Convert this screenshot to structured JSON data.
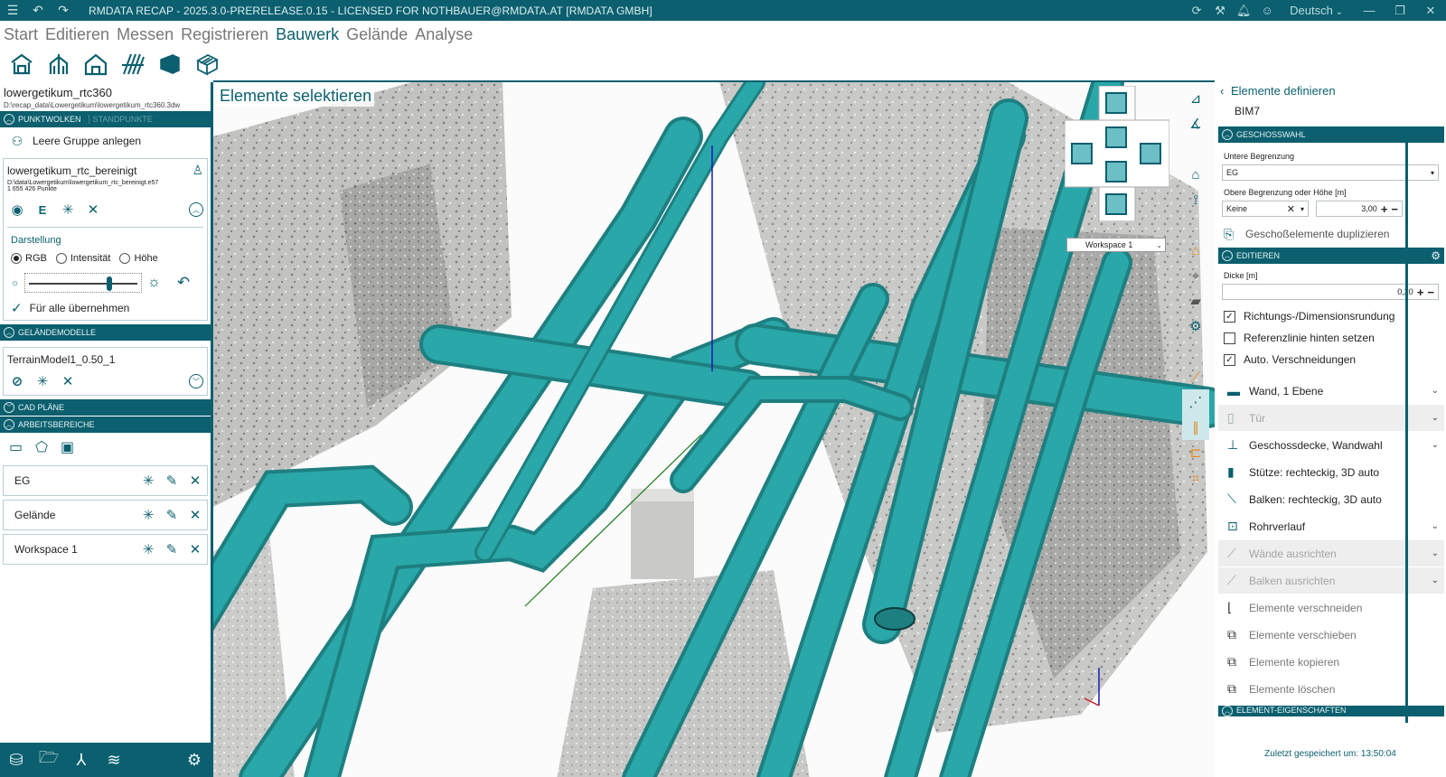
{
  "titlebar": {
    "title": "RMDATA RECAP - 2025.3.0-PRERELEASE.0.15 - LICENSED FOR NOTHBAUER@RMDATA.AT [RMDATA GMBH]",
    "language": "Deutsch"
  },
  "menu": {
    "items": [
      "Start",
      "Editieren",
      "Messen",
      "Registrieren",
      "Bauwerk",
      "Gelände",
      "Analyse"
    ],
    "active": "Bauwerk"
  },
  "left": {
    "project_name": "lowergetikum_rtc360",
    "project_path": "D:\\recap_data\\Lowergetikum\\lowergetikum_rtc360.3dw",
    "pointclouds_header": "PUNKTWOLKEN",
    "standpoints_header": "STANDPUNKTE",
    "new_group": "Leere Gruppe anlegen",
    "cloud": {
      "name": "lowergetikum_rtc_bereinigt",
      "path": "D:\\data\\Lowergetikum\\lowergetikum_rtc_bereinigt.e57",
      "points": "1 655 426 Punkte",
      "e_label": "E"
    },
    "display": {
      "title": "Darstellung",
      "options": [
        "RGB",
        "Intensität",
        "Höhe"
      ],
      "apply_all": "Für alle übernehmen"
    },
    "terrain_header": "GELÄNDEMODELLE",
    "terrain_model": "TerrainModel1_0.50_1",
    "cad_header": "CAD PLÄNE",
    "workspaces_header": "ARBEITSBEREICHE",
    "workspaces": [
      "EG",
      "Gelände",
      "Workspace 1"
    ]
  },
  "viewport": {
    "title": "Elemente selektieren",
    "workspace_select": "Workspace 1"
  },
  "right": {
    "back_title": "Elemente definieren",
    "subtitle": "BIM7",
    "floor_header": "GESCHOSSWAHL",
    "lower_label": "Untere Begrenzung",
    "lower_value": "EG",
    "upper_label": "Obere Begrenzung oder Höhe [m]",
    "upper_value": "Keine",
    "upper_height": "3,00",
    "duplicate_label": "Geschoßelemente duplizieren",
    "edit_header": "EDITIEREN",
    "thickness_label": "Dicke [m]",
    "thickness_value": "0,20",
    "checks": [
      {
        "label": "Richtungs-/Dimensionsrundung",
        "checked": true
      },
      {
        "label": "Referenzlinie hinten setzen",
        "checked": false
      },
      {
        "label": "Auto. Verschneidungen",
        "checked": true
      }
    ],
    "items": [
      {
        "label": "Wand, 1 Ebene",
        "icon": "wall-icon",
        "grey": false,
        "chev": true
      },
      {
        "label": "Tür",
        "icon": "door-icon",
        "grey": true,
        "chev": true
      },
      {
        "label": "Geschossdecke, Wandwahl",
        "icon": "slab-icon",
        "grey": false,
        "chev": true
      },
      {
        "label": "Stütze: rechteckig, 3D auto",
        "icon": "column-icon",
        "grey": false,
        "chev": false
      },
      {
        "label": "Balken: rechteckig, 3D auto",
        "icon": "beam-icon",
        "grey": false,
        "chev": false
      },
      {
        "label": "Rohrverlauf",
        "icon": "pipe-icon",
        "grey": false,
        "chev": true
      },
      {
        "label": "Wände ausrichten",
        "icon": "align-walls-icon",
        "grey": true,
        "chev": true
      },
      {
        "label": "Balken ausrichten",
        "icon": "align-beams-icon",
        "grey": true,
        "chev": true
      },
      {
        "label": "Elemente verschneiden",
        "icon": "intersect-icon",
        "grey": false,
        "chev": false,
        "dim": true
      },
      {
        "label": "Elemente verschieben",
        "icon": "move-icon",
        "grey": false,
        "chev": false,
        "dim": true
      },
      {
        "label": "Elemente kopieren",
        "icon": "copy-icon",
        "grey": false,
        "chev": false,
        "dim": true
      },
      {
        "label": "Elemente löschen",
        "icon": "delete-icon",
        "grey": false,
        "chev": false,
        "dim": true
      }
    ],
    "props_header": "ELEMENT-EIGENSCHAFTEN",
    "saved": "Zuletzt gespeichert um: 13:50:04"
  },
  "colors": {
    "accent": "#0b5f6e",
    "pipe": "#2aa7a8"
  }
}
